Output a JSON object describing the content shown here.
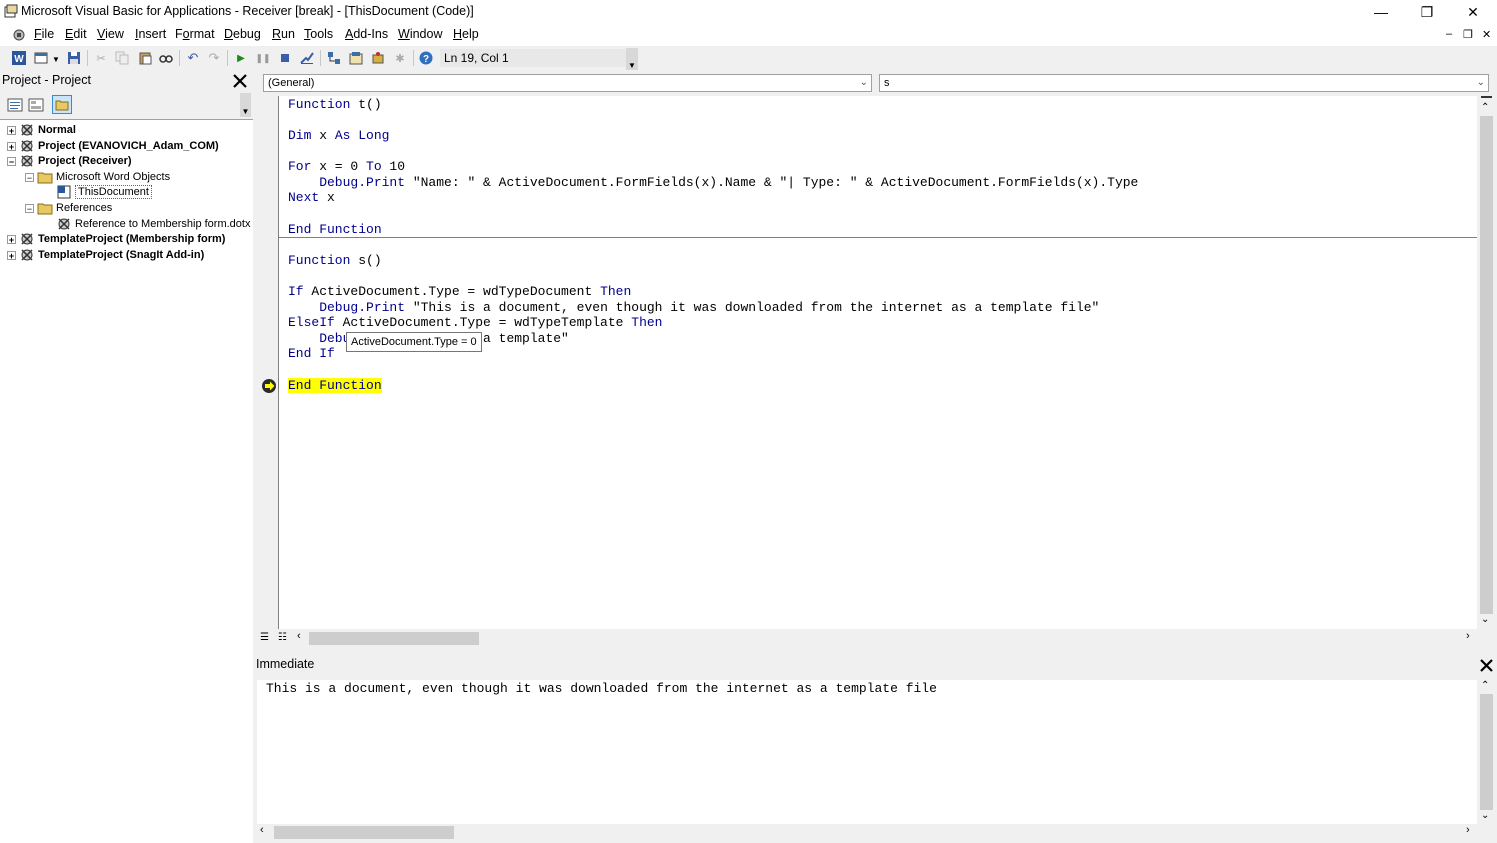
{
  "window": {
    "title": "Microsoft Visual Basic for Applications - Receiver [break] - [ThisDocument (Code)]",
    "minimize": "—",
    "restore": "❐",
    "close": "✕"
  },
  "menu": {
    "items": [
      {
        "pre": "",
        "acc": "F",
        "post": "ile"
      },
      {
        "pre": "",
        "acc": "E",
        "post": "dit"
      },
      {
        "pre": "",
        "acc": "V",
        "post": "iew"
      },
      {
        "pre": "",
        "acc": "I",
        "post": "nsert"
      },
      {
        "pre": "F",
        "acc": "o",
        "post": "rmat"
      },
      {
        "pre": "",
        "acc": "D",
        "post": "ebug"
      },
      {
        "pre": "",
        "acc": "R",
        "post": "un"
      },
      {
        "pre": "",
        "acc": "T",
        "post": "ools"
      },
      {
        "pre": "",
        "acc": "A",
        "post": "dd-Ins"
      },
      {
        "pre": "",
        "acc": "W",
        "post": "indow"
      },
      {
        "pre": "",
        "acc": "H",
        "post": "elp"
      }
    ],
    "mdi_min": "–",
    "mdi_restore": "❐",
    "mdi_close": "✕"
  },
  "toolbar": {
    "position": "Ln 19, Col 1"
  },
  "project": {
    "title": "Project - Project",
    "tree": [
      {
        "label": "Normal",
        "expander": "+"
      },
      {
        "label": "Project (EVANOVICH_Adam_COM)",
        "expander": "+"
      },
      {
        "label": "Project (Receiver)",
        "expander": "−"
      },
      {
        "label": "Microsoft Word Objects",
        "expander": "−"
      },
      {
        "label": "ThisDocument",
        "expander": ""
      },
      {
        "label": "References",
        "expander": "−"
      },
      {
        "label": "Reference to Membership form.dotx",
        "expander": ""
      },
      {
        "label": "TemplateProject (Membership form)",
        "expander": "+"
      },
      {
        "label": "TemplateProject (SnagIt Add-in)",
        "expander": "+"
      }
    ]
  },
  "code": {
    "object_combo": "(General)",
    "procedure_combo": "s",
    "lines": [
      "Function t()",
      "",
      "Dim x As Long",
      "",
      "For x = 0 To 10",
      "    Debug.Print \"Name: \" & ActiveDocument.FormFields(x).Name & \"| Type: \" & ActiveDocument.FormFields(x).Type",
      "Next x",
      "",
      "End Function",
      "",
      "Function s()",
      "",
      "If ActiveDocument.Type = wdTypeDocument Then",
      "    Debug.Print \"This is a document, even though it was downloaded from the internet as a template file\"",
      "ElseIf ActiveDocument.Type = wdTypeTemplate Then",
      "    Debug.Print \"This is a template\"",
      "End If",
      "",
      "End Function"
    ],
    "tooltip": "ActiveDocument.Type = 0",
    "current_line_index": 18
  },
  "immediate": {
    "title": "Immediate",
    "close": "✕",
    "output": "This is a document, even though it was downloaded from the internet as a template file"
  },
  "icons": [
    "app-icon",
    "word-icon",
    "insert-module-icon",
    "save-icon",
    "cut-icon",
    "copy-icon",
    "paste-icon",
    "find-icon",
    "undo-icon",
    "redo-icon",
    "run-icon",
    "break-icon",
    "reset-icon",
    "design-mode-icon",
    "project-explorer-icon",
    "properties-icon",
    "object-browser-icon",
    "toolbox-icon",
    "help-icon"
  ],
  "colors": {
    "keyword": "#00008b",
    "execution_highlight": "#ffff00",
    "arrow": "#ffff00"
  }
}
